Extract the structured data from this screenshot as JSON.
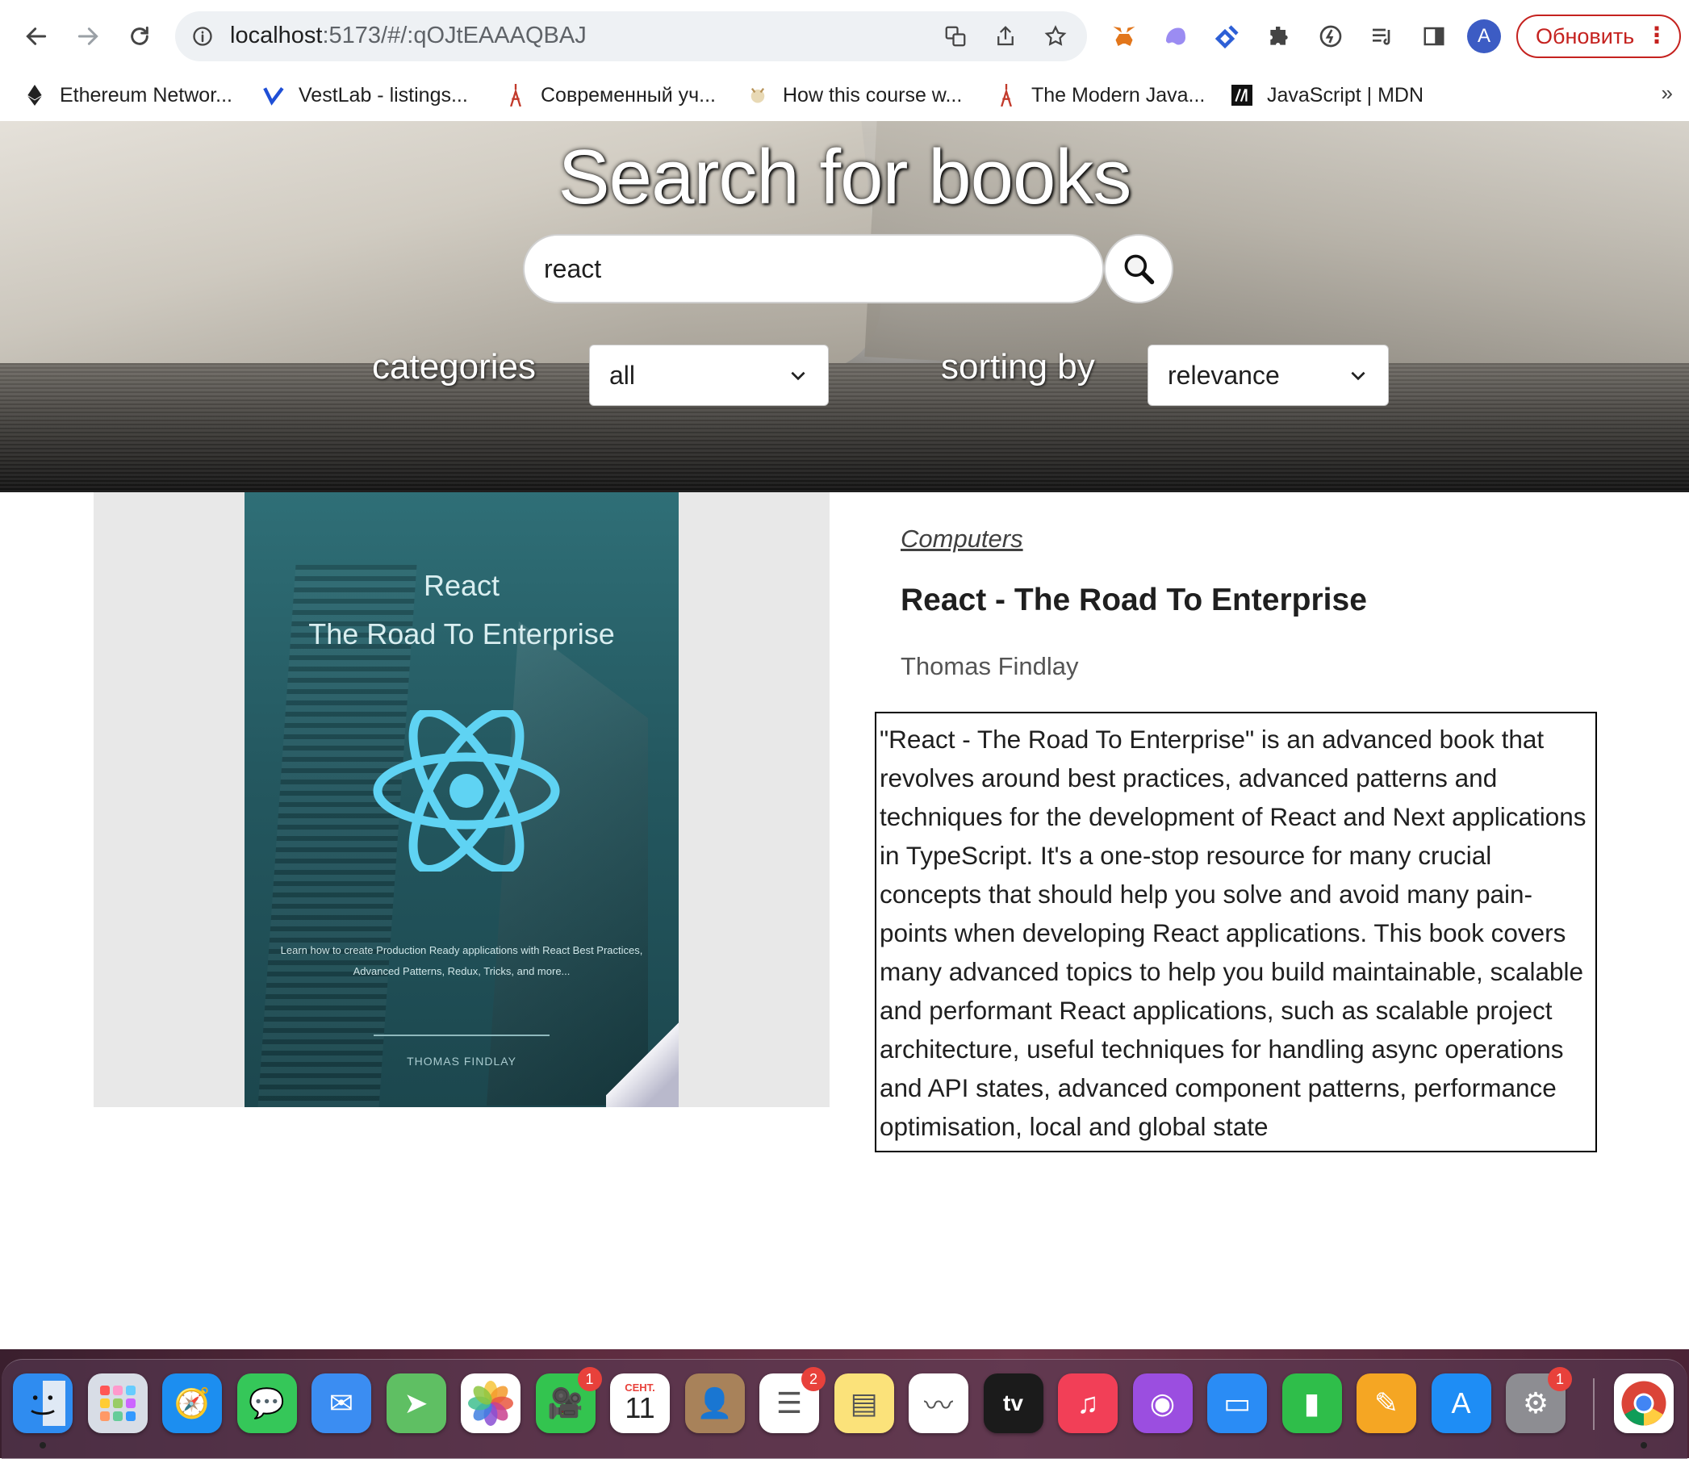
{
  "browser": {
    "url_host": "localhost",
    "url_rest": ":5173/#/:qOJtEAAAQBAJ",
    "avatar_letter": "A",
    "update_label": "Обновить",
    "bookmarks": [
      {
        "label": "Ethereum Networ...",
        "icon": "ethereum-icon"
      },
      {
        "label": "VestLab - listings...",
        "icon": "vestlab-icon"
      },
      {
        "label": "Современный уч...",
        "icon": "javascript-info-icon"
      },
      {
        "label": "How this course w...",
        "icon": "course-icon"
      },
      {
        "label": "The Modern Java...",
        "icon": "javascript-info-icon"
      },
      {
        "label": "JavaScript | MDN",
        "icon": "mdn-icon"
      }
    ],
    "bookmarks_more": "»"
  },
  "hero": {
    "title": "Search for books",
    "search_value": "react",
    "categories_label": "categories",
    "categories_value": "all",
    "sorting_label": "sorting by",
    "sorting_value": "relevance"
  },
  "book": {
    "cover": {
      "title_line1": "React",
      "title_line2": "The Road To Enterprise",
      "tagline": "Learn how to create Production Ready applications with React Best Practices, Advanced Patterns, Redux, Tricks, and more...",
      "author": "THOMAS FINDLAY"
    },
    "category": "Computers",
    "title": "React - The Road To Enterprise",
    "author": "Thomas Findlay",
    "description": "\"React - The Road To Enterprise\" is an advanced book that revolves around best practices, advanced patterns and techniques for the development of React and Next applications in TypeScript. It's a one-stop resource for many crucial concepts that should help you solve and avoid many pain-points when developing React applications. This book covers many advanced topics to help you build maintainable, scalable and performant React applications, such as scalable project architecture, useful techniques for handling async operations and API states, advanced component patterns, performance optimisation, local and global state"
  },
  "dock": {
    "apps": [
      {
        "name": "finder",
        "color": "#2f8cf0"
      },
      {
        "name": "launchpad",
        "color": "#d8dde6"
      },
      {
        "name": "safari",
        "color": "#1c8ef0"
      },
      {
        "name": "messages",
        "color": "#35c759"
      },
      {
        "name": "mail",
        "color": "#3b8df2"
      },
      {
        "name": "maps",
        "color": "#5fbf63"
      },
      {
        "name": "photos",
        "color": "#ffffff"
      },
      {
        "name": "facetime",
        "color": "#33c44f",
        "badge": "1"
      },
      {
        "name": "calendar",
        "color": "#ffffff",
        "month": "СЕНТ.",
        "day": "11"
      },
      {
        "name": "contacts",
        "color": "#a8825a"
      },
      {
        "name": "reminders",
        "color": "#ffffff",
        "badge": "2"
      },
      {
        "name": "notes",
        "color": "#fbe27a"
      },
      {
        "name": "freeform",
        "color": "#ffffff"
      },
      {
        "name": "tv",
        "color": "#1b1b1b",
        "label": "tv"
      },
      {
        "name": "music",
        "color": "#f23f57"
      },
      {
        "name": "podcasts",
        "color": "#9b4ee0"
      },
      {
        "name": "keynote",
        "color": "#2a8cf5"
      },
      {
        "name": "numbers",
        "color": "#2fbe4a"
      },
      {
        "name": "pages",
        "color": "#f5a623"
      },
      {
        "name": "app-store",
        "color": "#1e8df5"
      },
      {
        "name": "system-settings",
        "color": "#8d8d92",
        "badge": "1"
      },
      {
        "name": "chrome",
        "color": "#ffffff"
      }
    ]
  }
}
